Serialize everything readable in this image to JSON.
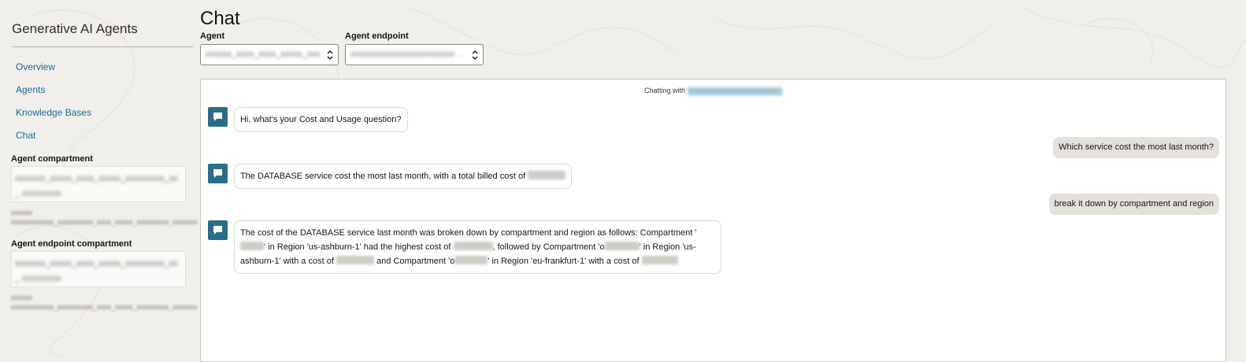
{
  "sidebar": {
    "title": "Generative AI Agents",
    "nav": [
      {
        "label": "Overview"
      },
      {
        "label": "Agents"
      },
      {
        "label": "Knowledge Bases"
      },
      {
        "label": "Chat"
      }
    ],
    "agent_compartment_label": "Agent compartment",
    "agent_endpoint_compartment_label": "Agent endpoint compartment"
  },
  "header": {
    "title": "Chat",
    "agent_label": "Agent",
    "agent_endpoint_label": "Agent endpoint"
  },
  "chat": {
    "chatting_with_prefix": "Chatting with",
    "messages": [
      {
        "role": "bot",
        "text": "Hi, what's your Cost and Usage question?"
      },
      {
        "role": "user",
        "text": "Which service cost the most last month?"
      },
      {
        "role": "bot",
        "text": "The DATABASE service cost the most last month, with a total billed cost of"
      },
      {
        "role": "user",
        "text": "break it down by compartment and region"
      },
      {
        "role": "bot",
        "parts": [
          "The cost of the DATABASE service last month was broken down by compartment and region as follows: Compartment '",
          "' in Region 'us-ashburn-1' had the highest cost of ",
          ", followed by Compartment 'o",
          "' in Region 'us-ashburn-1' with a cost of ",
          " and Compartment 'o",
          "' in Region 'eu-frankfurt-1' with a cost of "
        ]
      }
    ]
  },
  "colors": {
    "accent": "#2b6c87",
    "link": "#1f6a8a",
    "user_bubble": "#e4e1dc",
    "background": "#f1efec"
  },
  "icons": {
    "bot": "chat-bubble-icon",
    "select": "up-down-chevron-icon"
  }
}
